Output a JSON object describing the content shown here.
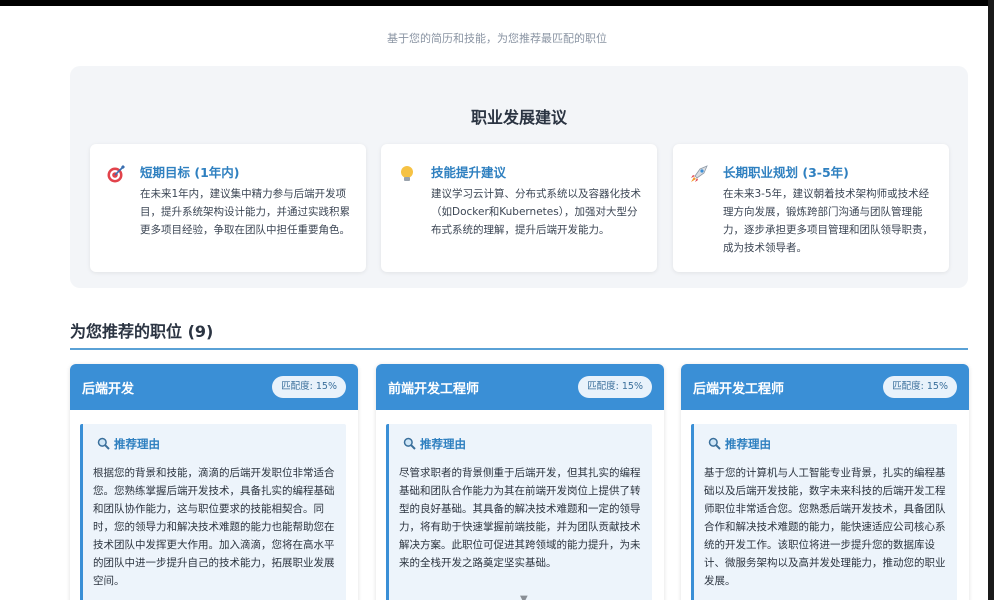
{
  "subtitle": "基于您的简历和技能，为您推荐最匹配的职位",
  "advice": {
    "title": "职业发展建议",
    "cards": [
      {
        "icon": "target-icon",
        "title": "短期目标 (1年内)",
        "body": "在未来1年内，建议集中精力参与后端开发项目，提升系统架构设计能力，并通过实践积累更多项目经验，争取在团队中担任重要角色。"
      },
      {
        "icon": "lightbulb-icon",
        "title": "技能提升建议",
        "body": "建议学习云计算、分布式系统以及容器化技术（如Docker和Kubernetes），加强对大型分布式系统的理解，提升后端开发能力。"
      },
      {
        "icon": "rocket-icon",
        "title": "长期职业规划 (3-5年)",
        "body": "在未来3-5年，建议朝着技术架构师或技术经理方向发展，锻炼跨部门沟通与团队管理能力，逐步承担更多项目管理和团队领导职责，成为技术领导者。"
      }
    ]
  },
  "recommendations": {
    "heading": "为您推荐的职位 (9)",
    "reason_label": "推荐理由",
    "jobs": [
      {
        "title": "后端开发",
        "match": "匹配度: 15%",
        "reason": "根据您的背景和技能，滴滴的后端开发职位非常适合您。您熟练掌握后端开发技术，具备扎实的编程基础和团队协作能力，这与职位要求的技能相契合。同时，您的领导力和解决技术难题的能力也能帮助您在技术团队中发挥更大作用。加入滴滴，您将在高水平的团队中进一步提升自己的技术能力，拓展职业发展空间。"
      },
      {
        "title": "前端开发工程师",
        "match": "匹配度: 15%",
        "reason": "尽管求职者的背景侧重于后端开发，但其扎实的编程基础和团队合作能力为其在前端开发岗位上提供了转型的良好基础。其具备的解决技术难题和一定的领导力，将有助于快速掌握前端技能，并为团队贡献技术解决方案。此职位可促进其跨领域的能力提升，为未来的全栈开发之路奠定坚实基础。"
      },
      {
        "title": "后端开发工程师",
        "match": "匹配度: 15%",
        "reason": "基于您的计算机与人工智能专业背景，扎实的编程基础以及后端开发技能，数字未来科技的后端开发工程师职位非常适合您。您熟悉后端开发技术，具备团队合作和解决技术难题的能力，能快速适应公司核心系统的开发工作。该职位将进一步提升您的数据库设计、微服务架构以及高并发处理能力，推动您的职业发展。"
      }
    ]
  },
  "scroll_indicator": "▼",
  "colors": {
    "accent": "#3a8fd6",
    "title": "#2f80c0",
    "panel": "#f3f5f8"
  }
}
